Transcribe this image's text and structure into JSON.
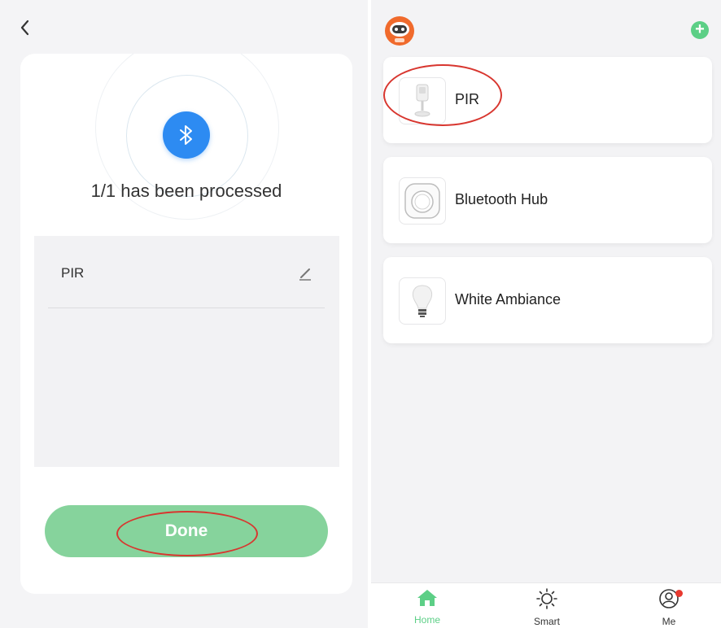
{
  "left": {
    "status_text": "1/1 has been processed",
    "devices": [
      {
        "name": "PIR"
      }
    ],
    "done_label": "Done"
  },
  "right": {
    "devices": [
      {
        "name": "PIR",
        "icon": "pir-sensor-icon"
      },
      {
        "name": "Bluetooth Hub",
        "icon": "bluetooth-hub-icon"
      },
      {
        "name": "White Ambiance",
        "icon": "light-bulb-icon"
      }
    ],
    "tabs": [
      {
        "label": "Home",
        "icon": "home-icon",
        "active": true
      },
      {
        "label": "Smart",
        "icon": "sun-icon",
        "active": false
      },
      {
        "label": "Me",
        "icon": "user-icon",
        "active": false
      }
    ]
  },
  "colors": {
    "accent_green": "#86d39c",
    "active_green": "#5ccf86",
    "bluetooth_blue": "#2d8bf2",
    "annotation_red": "#d8362f"
  }
}
